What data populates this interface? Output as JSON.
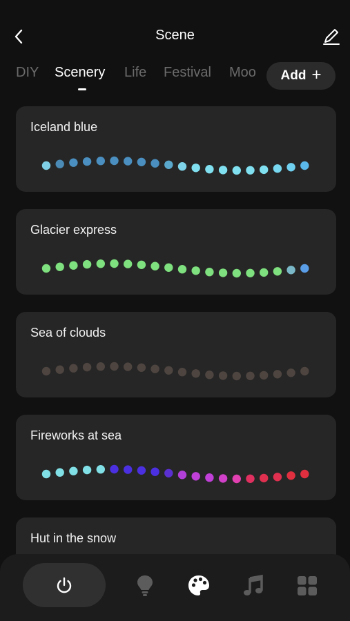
{
  "header": {
    "title": "Scene",
    "back_icon": "chevron-left-icon",
    "edit_icon": "pencil-icon"
  },
  "tabs": [
    {
      "label": "DIY",
      "active": false
    },
    {
      "label": "Scenery",
      "active": true
    },
    {
      "label": "Life",
      "active": false
    },
    {
      "label": "Festival",
      "active": false
    },
    {
      "label": "Moo",
      "active": false
    }
  ],
  "add_button": {
    "label": "Add",
    "icon": "plus-icon"
  },
  "scenes": [
    {
      "name": "Iceland blue",
      "dot_colors": [
        "#7fd0e6",
        "#4a8ab5",
        "#4a8fbf",
        "#4a8fbf",
        "#4a8fbf",
        "#4a8fbf",
        "#4a8fbf",
        "#4a8fbf",
        "#4a8fbf",
        "#5aa8cc",
        "#7fd4ea",
        "#80e0f0",
        "#80e0f0",
        "#80e0f0",
        "#80e0f0",
        "#80e0f0",
        "#80e0f0",
        "#78d8f0",
        "#70d0f0",
        "#5ab8ea"
      ]
    },
    {
      "name": "Glacier express",
      "dot_colors": [
        "#7ee07e",
        "#7ee07e",
        "#7ee07e",
        "#7ee07e",
        "#7ee07e",
        "#7ee07e",
        "#7ee07e",
        "#7ee07e",
        "#7ee07e",
        "#7ee07e",
        "#7ee07e",
        "#7ee07e",
        "#7ee07e",
        "#7ee07e",
        "#7ee07e",
        "#7ee07e",
        "#7ee07e",
        "#7ee07e",
        "#7ab8c8",
        "#5a9ee8"
      ]
    },
    {
      "name": "Sea of clouds",
      "dot_colors": [
        "#4e4540",
        "#4e4540",
        "#4e4540",
        "#4e4540",
        "#4e4540",
        "#4e4540",
        "#4e4540",
        "#4e4540",
        "#4e4540",
        "#4e4540",
        "#4e4540",
        "#4e4540",
        "#4e4540",
        "#4e4540",
        "#4e4540",
        "#4e4540",
        "#4e4540",
        "#4e4540",
        "#4e4540",
        "#4e4540"
      ]
    },
    {
      "name": "Fireworks at sea",
      "dot_colors": [
        "#80e0e6",
        "#80e0e6",
        "#80e0e6",
        "#80e0e6",
        "#80e0e6",
        "#4a30e0",
        "#4a30e0",
        "#4a30e0",
        "#4a30e0",
        "#5a30d0",
        "#b040d8",
        "#c040d8",
        "#c040d8",
        "#d040c8",
        "#e040b0",
        "#e03060",
        "#e03050",
        "#e03050",
        "#e03040",
        "#e03040"
      ]
    },
    {
      "name": "Hut in the snow",
      "dot_colors": []
    }
  ],
  "bottom_nav": [
    {
      "name": "power",
      "icon": "power-icon",
      "active": true
    },
    {
      "name": "bulb",
      "icon": "lightbulb-icon",
      "active": false
    },
    {
      "name": "scene",
      "icon": "palette-icon",
      "active": true
    },
    {
      "name": "music",
      "icon": "music-note-icon",
      "active": false
    },
    {
      "name": "more",
      "icon": "grid-icon",
      "active": false
    }
  ]
}
